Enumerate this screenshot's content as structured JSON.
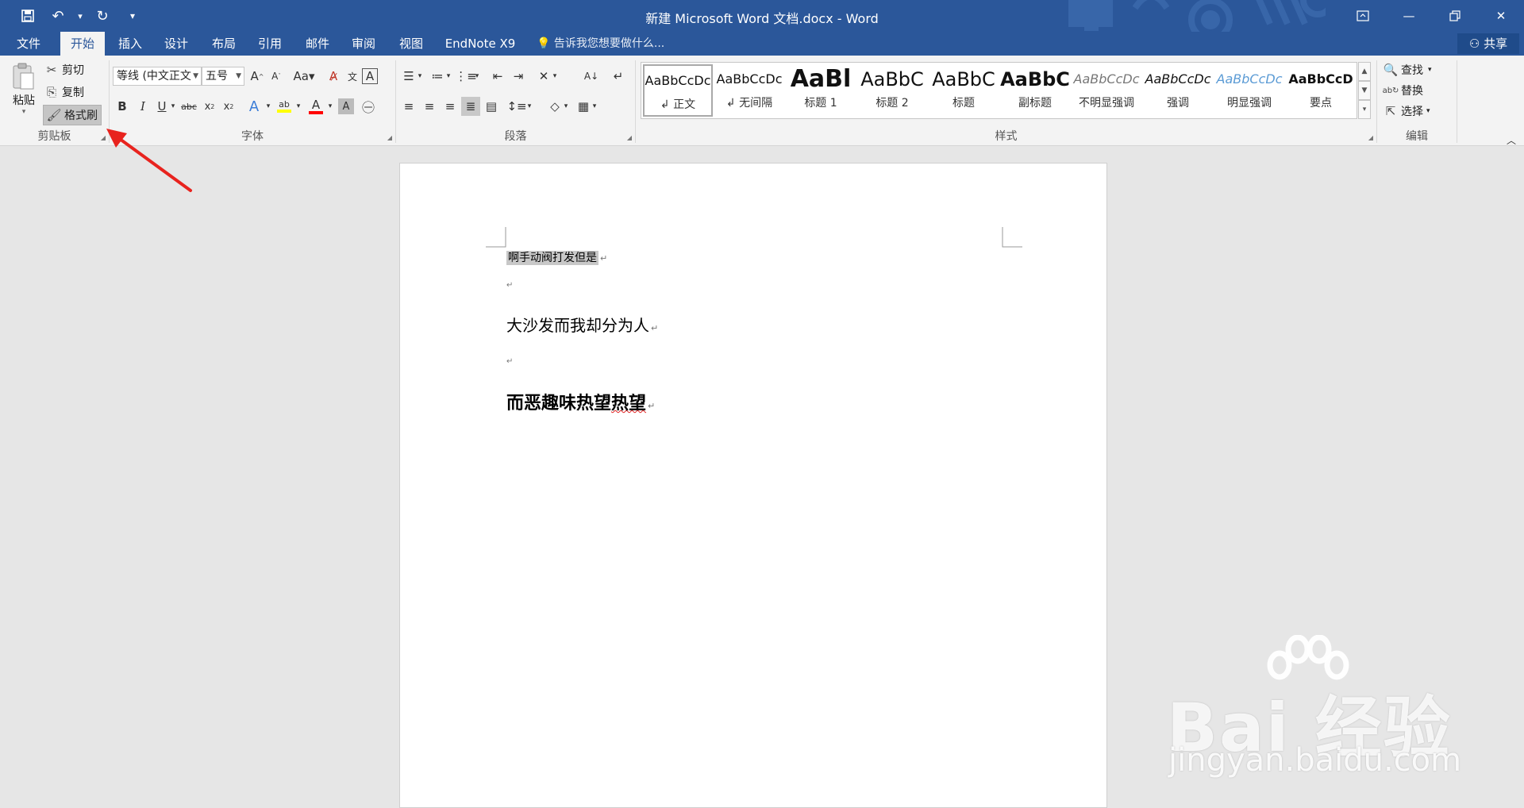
{
  "titlebar": {
    "title": "新建 Microsoft Word 文档.docx - Word",
    "qat": [
      {
        "name": "save-icon",
        "glyph": "💾"
      },
      {
        "name": "undo-icon",
        "glyph": "↶"
      },
      {
        "name": "undo-dropdown-icon",
        "glyph": "▾"
      },
      {
        "name": "redo-icon",
        "glyph": "↻"
      },
      {
        "name": "customize-qat-icon",
        "glyph": "₌"
      }
    ],
    "window_buttons": [
      {
        "name": "ribbon-display-options-icon",
        "glyph": "⊡"
      },
      {
        "name": "minimize-icon",
        "glyph": "—"
      },
      {
        "name": "restore-icon",
        "glyph": "❐"
      },
      {
        "name": "close-icon",
        "glyph": "✕"
      }
    ],
    "accent": "#2b579a"
  },
  "tabs": [
    {
      "label": "文件",
      "active": false
    },
    {
      "label": "开始",
      "active": true
    },
    {
      "label": "插入",
      "active": false
    },
    {
      "label": "设计",
      "active": false
    },
    {
      "label": "布局",
      "active": false
    },
    {
      "label": "引用",
      "active": false
    },
    {
      "label": "邮件",
      "active": false
    },
    {
      "label": "审阅",
      "active": false
    },
    {
      "label": "视图",
      "active": false
    },
    {
      "label": "EndNote X9",
      "active": false
    }
  ],
  "tell_me": "告诉我您想要做什么...",
  "share": "共享",
  "clipboard": {
    "group_label": "剪贴板",
    "paste": "粘贴",
    "cut": "剪切",
    "copy": "复制",
    "format_painter": "格式刷"
  },
  "font": {
    "group_label": "字体",
    "font_name": "等线 (中文正文",
    "font_size": "五号"
  },
  "paragraph": {
    "group_label": "段落"
  },
  "styles": {
    "group_label": "样式",
    "items": [
      {
        "preview": "AaBbCcDc",
        "name": "↲ 正文",
        "selected": true
      },
      {
        "preview": "AaBbCcDc",
        "name": "↲ 无间隔",
        "selected": false
      },
      {
        "preview": "AaBl",
        "name": "标题 1",
        "selected": false
      },
      {
        "preview": "AaBbC",
        "name": "标题 2",
        "selected": false
      },
      {
        "preview": "AaBbC",
        "name": "标题",
        "selected": false
      },
      {
        "preview": "AaBbC",
        "name": "副标题",
        "selected": false
      },
      {
        "preview": "AaBbCcDc",
        "name": "不明显强调",
        "selected": false
      },
      {
        "preview": "AaBbCcDc",
        "name": "强调",
        "selected": false
      },
      {
        "preview": "AaBbCcDc",
        "name": "明显强调",
        "selected": false
      },
      {
        "preview": "AaBbCcD",
        "name": "要点",
        "selected": false
      }
    ]
  },
  "editing": {
    "group_label": "编辑",
    "find": "查找",
    "replace": "替换",
    "select": "选择"
  },
  "document": {
    "para1": "啊手动阀打发但是",
    "para3": "大沙发而我却分为人",
    "para5_plain": "而恶趣味热望",
    "para5_squiggle": "热望",
    "para_mark": "↵"
  },
  "watermark": {
    "brand": "Bai 经验",
    "site": "jingyan.baidu.com"
  },
  "colors": {
    "highlight_swatch": "#ffff00",
    "font_color_swatch": "#ff0000",
    "annotation_arrow": "#e8231e"
  }
}
